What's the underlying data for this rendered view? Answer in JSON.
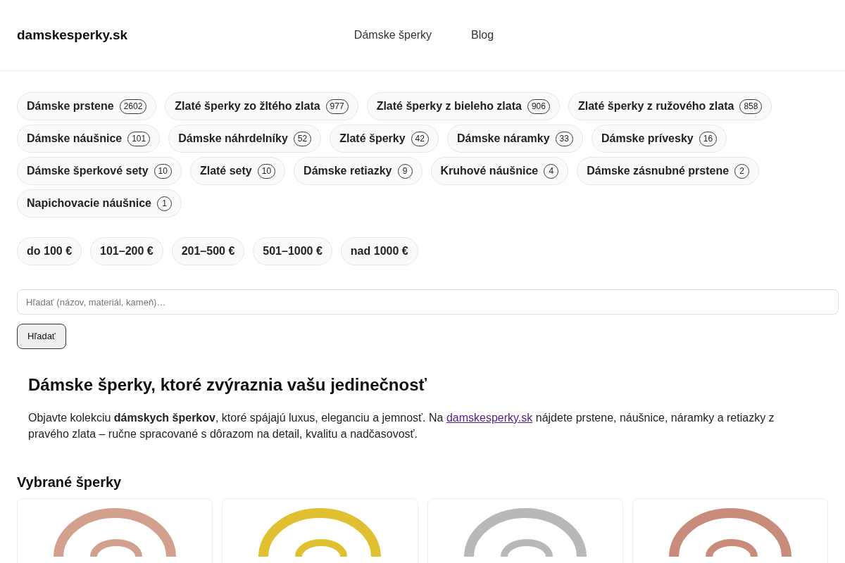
{
  "header": {
    "logo": "damskesperky.sk",
    "nav": [
      {
        "label": "Dámske šperky"
      },
      {
        "label": "Blog"
      }
    ]
  },
  "categories": [
    {
      "label": "Dámske prstene",
      "count": "2602"
    },
    {
      "label": "Zlaté šperky zo žltého zlata",
      "count": "977"
    },
    {
      "label": "Zlaté šperky z bieleho zlata",
      "count": "906"
    },
    {
      "label": "Zlaté šperky z ružového zlata",
      "count": "858"
    },
    {
      "label": "Dámske náušnice",
      "count": "101"
    },
    {
      "label": "Dámske náhrdelníky",
      "count": "52"
    },
    {
      "label": "Zlaté šperky",
      "count": "42"
    },
    {
      "label": "Dámske náramky",
      "count": "33"
    },
    {
      "label": "Dámske prívesky",
      "count": "16"
    },
    {
      "label": "Dámske šperkové sety",
      "count": "10"
    },
    {
      "label": "Zlaté sety",
      "count": "10"
    },
    {
      "label": "Dámske retiazky",
      "count": "9"
    },
    {
      "label": "Kruhové náušnice",
      "count": "4"
    },
    {
      "label": "Dámske zásnubné prstene",
      "count": "2"
    },
    {
      "label": "Napichovacie náušnice",
      "count": "1"
    }
  ],
  "price_filters": [
    {
      "label": "do 100 €"
    },
    {
      "label": "101–200 €"
    },
    {
      "label": "201–500 €"
    },
    {
      "label": "501–1000 €"
    },
    {
      "label": "nad 1000 €"
    }
  ],
  "search": {
    "placeholder": "Hľadať (názov, materiál, kameň)…",
    "button": "Hľadať"
  },
  "intro": {
    "heading": "Dámske šperky, ktoré zvýraznia vašu jedinečnosť",
    "text_before": "Objavte kolekciu **dámskych šperkov**, ktoré spájajú luxus, eleganciu a jemnosť. Na ",
    "link": "damskesperky.sk",
    "text_after": " nájdete prstene, náušnice, náramky a retiazky z pravého zlata – ručne spracované s dôrazom na detail, kvalitu a nadčasovosť."
  },
  "featured": {
    "title": "Vybrané šperky",
    "products": [
      {
        "color": "#d4a08e"
      },
      {
        "color": "#e0c030"
      },
      {
        "color": "#b8b8b8"
      },
      {
        "color": "#c98c7a"
      }
    ]
  }
}
